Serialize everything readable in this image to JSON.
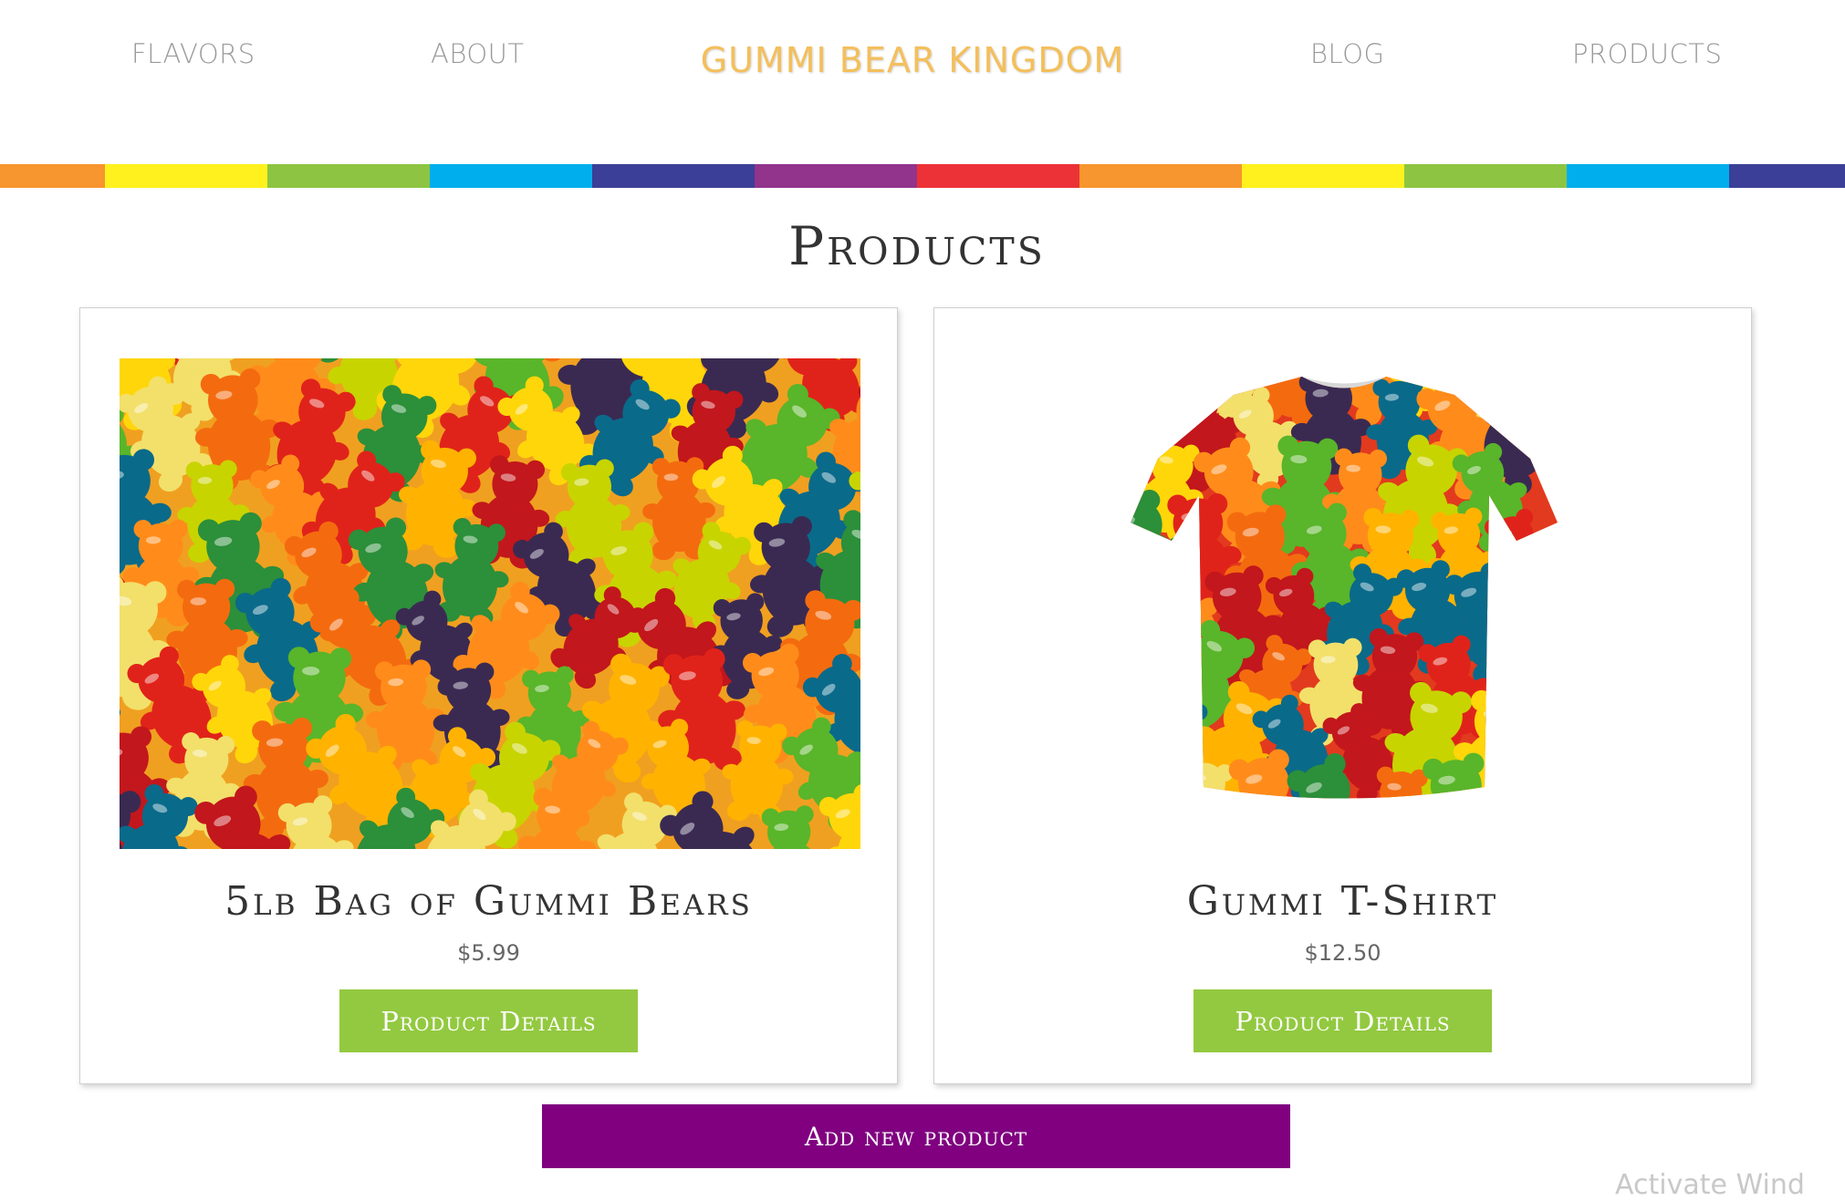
{
  "nav": {
    "links": [
      "FLAVORS",
      "ABOUT",
      "BLOG",
      "PRODUCTS"
    ],
    "brand": "GUMMI BEAR KINGDOM",
    "brand_color": "#f4bf5b"
  },
  "rainbow_colors": [
    "#f7952e",
    "#fff11e",
    "#8dc542",
    "#00aeed",
    "#3b3f97",
    "#92338c",
    "#ec3237",
    "#f7952e",
    "#fff11e",
    "#8dc542",
    "#00aeed",
    "#3b3f97"
  ],
  "page": {
    "title": "Products"
  },
  "products": [
    {
      "name": "5lb Bag of Gummi Bears",
      "price": "$5.99",
      "button": "Product Details",
      "image": "gummy-bears-photo"
    },
    {
      "name": "Gummi T-Shirt",
      "price": "$12.50",
      "button": "Product Details",
      "image": "gummy-tshirt-photo"
    }
  ],
  "actions": {
    "add_product": "Add new product",
    "add_color": "#800080",
    "details_color": "#93c940"
  },
  "watermark": "Activate Wind"
}
